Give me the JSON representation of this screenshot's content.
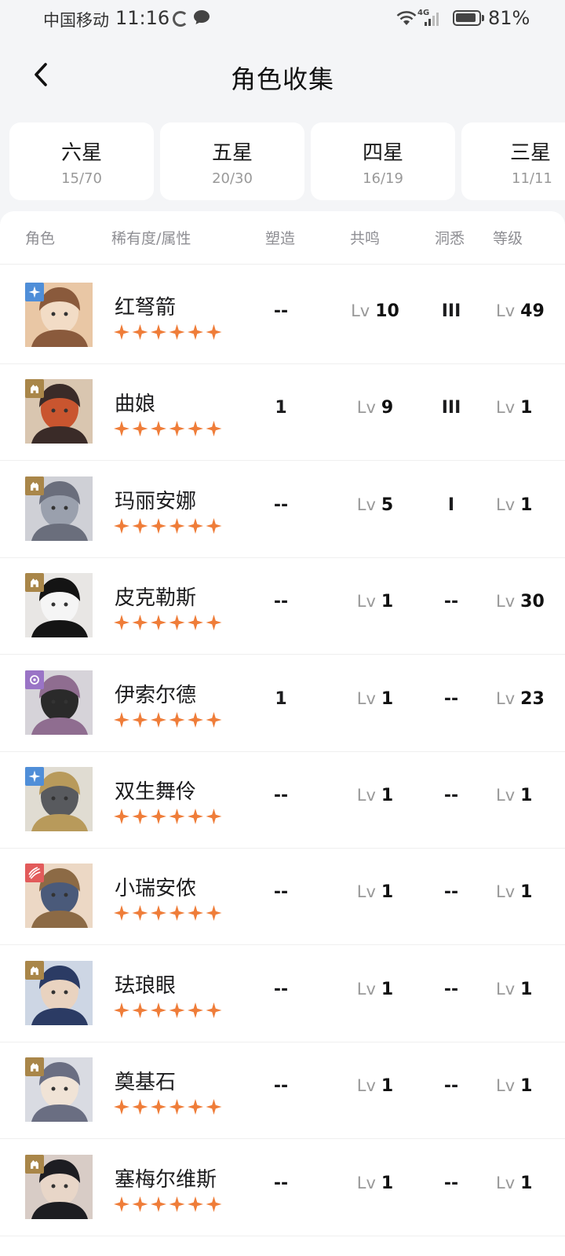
{
  "status": {
    "carrier": "中国移动",
    "time": "11:16",
    "network": "4G",
    "battery": "81%",
    "battery_level": 0.81
  },
  "header": {
    "title": "角色收集"
  },
  "tabs": [
    {
      "label": "六星",
      "count": "15/70"
    },
    {
      "label": "五星",
      "count": "20/30"
    },
    {
      "label": "四星",
      "count": "16/19"
    },
    {
      "label": "三星",
      "count": "11/11"
    }
  ],
  "columns": {
    "role": "角色",
    "rarity": "稀有度/属性",
    "shape": "塑造",
    "resonance": "共鸣",
    "insight": "洞悉",
    "level": "等级"
  },
  "colors": {
    "star": "#ef7d39",
    "attr_blue": "#4f8ed8",
    "attr_gold": "#a98649",
    "attr_purple": "#9a74c6",
    "attr_red": "#e25b5b"
  },
  "rows": [
    {
      "name": "红弩箭",
      "stars": 6,
      "attr": "blue-star-icon",
      "shape": "--",
      "res_prefix": "Lv",
      "res": "10",
      "insight": "III",
      "lvl_prefix": "Lv",
      "level": "49"
    },
    {
      "name": "曲娘",
      "stars": 6,
      "attr": "gold-beast-icon",
      "shape": "1",
      "res_prefix": "Lv",
      "res": "9",
      "insight": "III",
      "lvl_prefix": "Lv",
      "level": "1"
    },
    {
      "name": "玛丽安娜",
      "stars": 6,
      "attr": "gold-beast-icon",
      "shape": "--",
      "res_prefix": "Lv",
      "res": "5",
      "insight": "I",
      "lvl_prefix": "Lv",
      "level": "1"
    },
    {
      "name": "皮克勒斯",
      "stars": 6,
      "attr": "gold-beast-icon",
      "shape": "--",
      "res_prefix": "Lv",
      "res": "1",
      "insight": "--",
      "lvl_prefix": "Lv",
      "level": "30"
    },
    {
      "name": "伊索尔德",
      "stars": 6,
      "attr": "purple-spiral-icon",
      "shape": "1",
      "res_prefix": "Lv",
      "res": "1",
      "insight": "--",
      "lvl_prefix": "Lv",
      "level": "23"
    },
    {
      "name": "双生舞伶",
      "stars": 6,
      "attr": "blue-star-icon",
      "shape": "--",
      "res_prefix": "Lv",
      "res": "1",
      "insight": "--",
      "lvl_prefix": "Lv",
      "level": "1"
    },
    {
      "name": "小瑞安侬",
      "stars": 6,
      "attr": "red-claw-icon",
      "shape": "--",
      "res_prefix": "Lv",
      "res": "1",
      "insight": "--",
      "lvl_prefix": "Lv",
      "level": "1"
    },
    {
      "name": "珐琅眼",
      "stars": 6,
      "attr": "gold-beast-icon",
      "shape": "--",
      "res_prefix": "Lv",
      "res": "1",
      "insight": "--",
      "lvl_prefix": "Lv",
      "level": "1"
    },
    {
      "name": "奠基石",
      "stars": 6,
      "attr": "gold-beast-icon",
      "shape": "--",
      "res_prefix": "Lv",
      "res": "1",
      "insight": "--",
      "lvl_prefix": "Lv",
      "level": "1"
    },
    {
      "name": "塞梅尔维斯",
      "stars": 6,
      "attr": "gold-beast-icon",
      "shape": "--",
      "res_prefix": "Lv",
      "res": "1",
      "insight": "--",
      "lvl_prefix": "Lv",
      "level": "1"
    }
  ]
}
